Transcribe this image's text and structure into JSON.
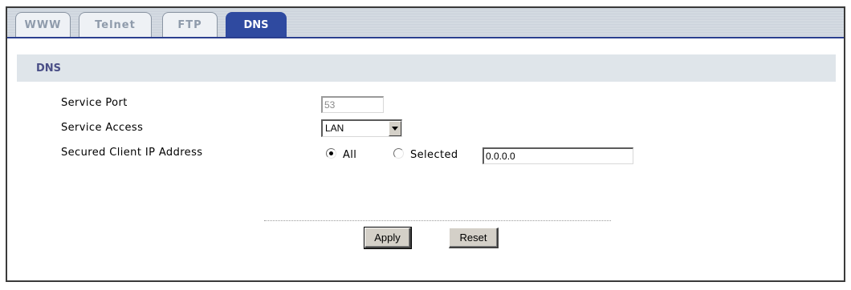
{
  "tabs": [
    {
      "label": "WWW",
      "active": false
    },
    {
      "label": "Telnet",
      "active": false
    },
    {
      "label": "FTP",
      "active": false
    },
    {
      "label": "DNS",
      "active": true
    }
  ],
  "section": {
    "title": "DNS"
  },
  "form": {
    "service_port": {
      "label": "Service Port",
      "value": "53",
      "disabled": true
    },
    "service_access": {
      "label": "Service Access",
      "selected": "LAN"
    },
    "secured_client_ip": {
      "label": "Secured Client IP Address",
      "option_all": "All",
      "option_selected": "Selected",
      "selected_option": "All",
      "ip_value": "0.0.0.0"
    }
  },
  "buttons": {
    "apply": "Apply",
    "reset": "Reset"
  },
  "colors": {
    "active_tab": "#2f4aa0",
    "section_header_bg": "#dfe5ea",
    "section_header_text": "#4a4f87",
    "tab_inactive_text": "#8f9bab"
  }
}
